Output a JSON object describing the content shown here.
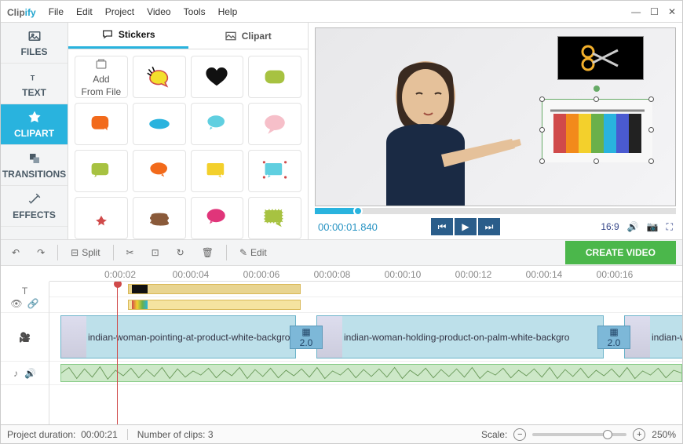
{
  "app": {
    "name_a": "Clip",
    "name_b": "ify"
  },
  "menu": [
    "File",
    "Edit",
    "Project",
    "Video",
    "Tools",
    "Help"
  ],
  "sidebar": [
    {
      "id": "files",
      "label": "FILES",
      "icon": "image"
    },
    {
      "id": "text",
      "label": "TEXT",
      "icon": "text"
    },
    {
      "id": "clipart",
      "label": "CLIPART",
      "icon": "star",
      "active": true
    },
    {
      "id": "transitions",
      "label": "TRANSITIONS",
      "icon": "layers"
    },
    {
      "id": "effects",
      "label": "EFFECTS",
      "icon": "wand"
    }
  ],
  "browser": {
    "tabs": [
      {
        "label": "Stickers",
        "active": true,
        "icon": "chat"
      },
      {
        "label": "Clipart",
        "icon": "picture"
      }
    ],
    "add_label_1": "Add",
    "add_label_2": "From File"
  },
  "preview": {
    "timecode": "00:00:01.840",
    "aspect": "16:9"
  },
  "toolbar": {
    "split": "Split",
    "edit": "Edit",
    "create": "CREATE VIDEO"
  },
  "ruler": [
    "0:00:02",
    "00:00:04",
    "00:00:06",
    "00:00:08",
    "00:00:10",
    "00:00:12",
    "00:00:14",
    "00:00:16"
  ],
  "clips": {
    "v1_label": "indian-woman-pointing-at-product-white-backgro",
    "v2_label": "indian-woman-holding-product-on-palm-white-backgro",
    "v3_label": "indian-wo",
    "trans": "2.0"
  },
  "status": {
    "duration_label": "Project duration:",
    "duration": "00:00:21",
    "clips_label": "Number of clips:",
    "clips": "3",
    "scale_label": "Scale:",
    "zoom": "250%"
  }
}
